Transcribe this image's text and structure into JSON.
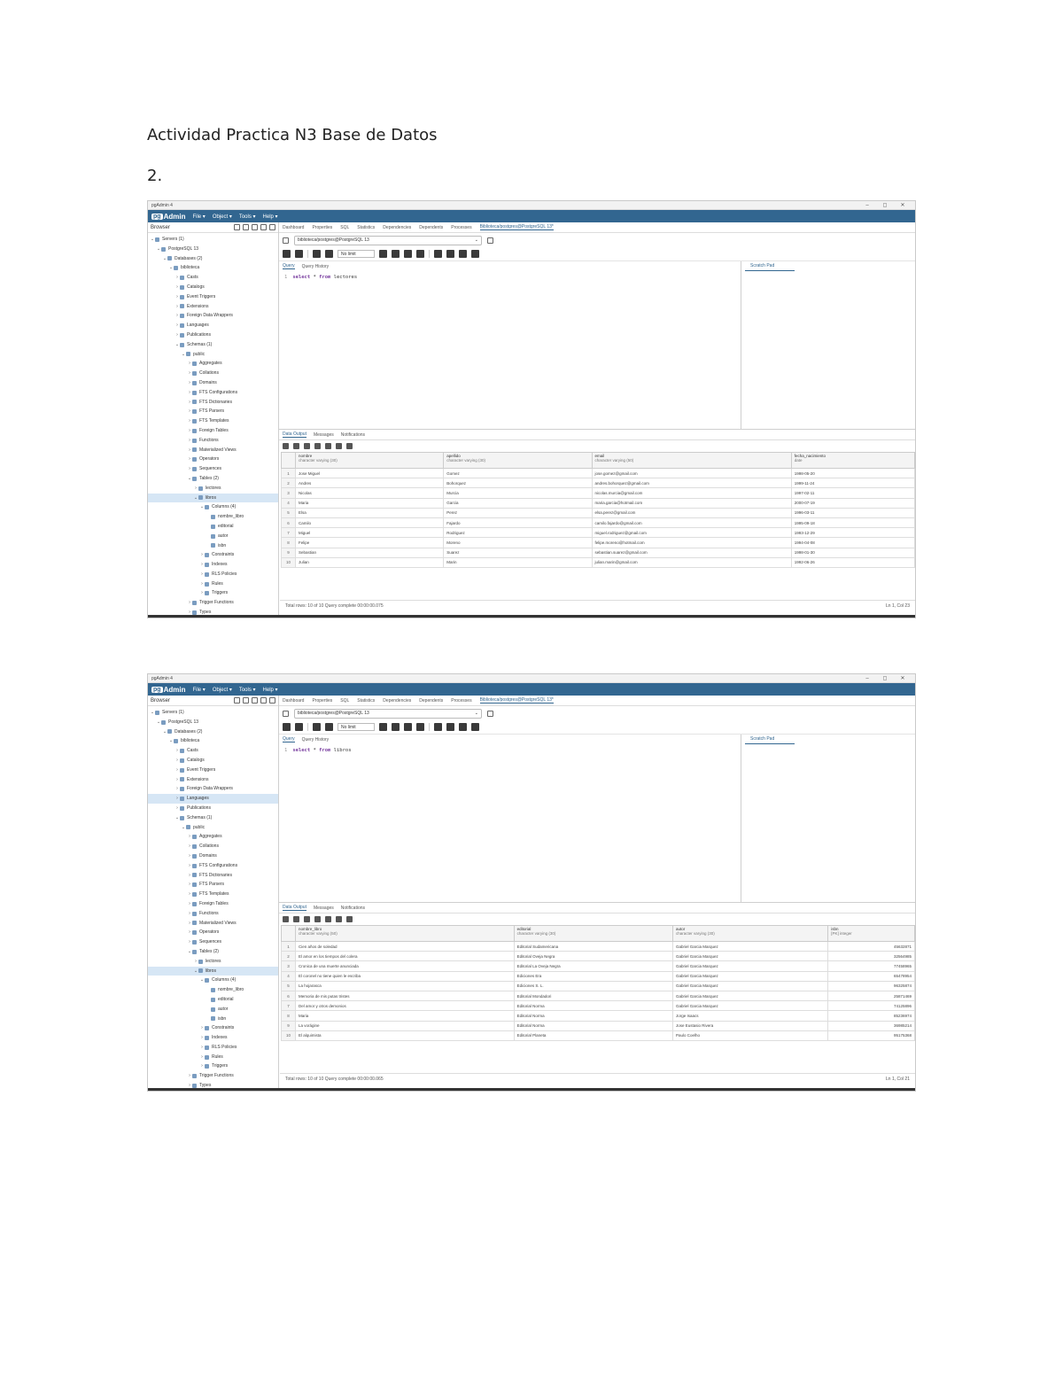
{
  "document": {
    "title": "Actividad Practica N3 Base de Datos",
    "section_number": "2."
  },
  "screenshots": [
    {
      "window_title": "pgAdmin 4",
      "logo_pg": "pg",
      "logo_admin": "Admin",
      "menu": [
        "File ▾",
        "Object ▾",
        "Tools ▾",
        "Help ▾"
      ],
      "browser_label": "Browser",
      "tabs": [
        "Dashboard",
        "Properties",
        "SQL",
        "Statistics",
        "Dependencies",
        "Dependents",
        "Processes",
        "Biblioteca/postgres@PostgreSQL 13*"
      ],
      "connection": "biblioteca/postgres@PostgreSQL 13",
      "no_limit": "No limit",
      "editor_tabs": [
        "Query",
        "Query History"
      ],
      "scratch_pad": "Scratch Pad",
      "code": {
        "line": "1",
        "keyword1": "select",
        "rest1": " * ",
        "keyword2": "from",
        "table": " lectores"
      },
      "output_tabs": [
        "Data Output",
        "Messages",
        "Notifications"
      ],
      "tree": [
        {
          "label": "Servers (1)",
          "indent": 0,
          "arrow": "⌄"
        },
        {
          "label": "PostgreSQL 13",
          "indent": 1,
          "arrow": "⌄"
        },
        {
          "label": "Databases (2)",
          "indent": 2,
          "arrow": "⌄"
        },
        {
          "label": "biblioteca",
          "indent": 3,
          "arrow": "⌄"
        },
        {
          "label": "Casts",
          "indent": 4,
          "arrow": "›"
        },
        {
          "label": "Catalogs",
          "indent": 4,
          "arrow": "›"
        },
        {
          "label": "Event Triggers",
          "indent": 4,
          "arrow": "›"
        },
        {
          "label": "Extensions",
          "indent": 4,
          "arrow": "›"
        },
        {
          "label": "Foreign Data Wrappers",
          "indent": 4,
          "arrow": "›"
        },
        {
          "label": "Languages",
          "indent": 4,
          "arrow": "›"
        },
        {
          "label": "Publications",
          "indent": 4,
          "arrow": "›"
        },
        {
          "label": "Schemas (1)",
          "indent": 4,
          "arrow": "⌄"
        },
        {
          "label": "public",
          "indent": 5,
          "arrow": "⌄"
        },
        {
          "label": "Aggregates",
          "indent": 6,
          "arrow": "›"
        },
        {
          "label": "Collations",
          "indent": 6,
          "arrow": "›"
        },
        {
          "label": "Domains",
          "indent": 6,
          "arrow": "›"
        },
        {
          "label": "FTS Configurations",
          "indent": 6,
          "arrow": "›"
        },
        {
          "label": "FTS Dictionaries",
          "indent": 6,
          "arrow": "›"
        },
        {
          "label": "FTS Parsers",
          "indent": 6,
          "arrow": "›"
        },
        {
          "label": "FTS Templates",
          "indent": 6,
          "arrow": "›"
        },
        {
          "label": "Foreign Tables",
          "indent": 6,
          "arrow": "›"
        },
        {
          "label": "Functions",
          "indent": 6,
          "arrow": "›"
        },
        {
          "label": "Materialized Views",
          "indent": 6,
          "arrow": "›"
        },
        {
          "label": "Operators",
          "indent": 6,
          "arrow": "›"
        },
        {
          "label": "Sequences",
          "indent": 6,
          "arrow": "›"
        },
        {
          "label": "Tables (2)",
          "indent": 6,
          "arrow": "⌄"
        },
        {
          "label": "lectores",
          "indent": 7,
          "arrow": "›"
        },
        {
          "label": "libros",
          "indent": 7,
          "arrow": "⌄",
          "selected": true
        },
        {
          "label": "Columns (4)",
          "indent": 8,
          "arrow": "⌄"
        },
        {
          "label": "nombre_libro",
          "indent": 9,
          "arrow": ""
        },
        {
          "label": "editorial",
          "indent": 9,
          "arrow": ""
        },
        {
          "label": "autor",
          "indent": 9,
          "arrow": ""
        },
        {
          "label": "isbn",
          "indent": 9,
          "arrow": ""
        },
        {
          "label": "Constraints",
          "indent": 8,
          "arrow": "›"
        },
        {
          "label": "Indexes",
          "indent": 8,
          "arrow": "›"
        },
        {
          "label": "RLS Policies",
          "indent": 8,
          "arrow": "›"
        },
        {
          "label": "Rules",
          "indent": 8,
          "arrow": "›"
        },
        {
          "label": "Triggers",
          "indent": 8,
          "arrow": "›"
        },
        {
          "label": "Trigger Functions",
          "indent": 6,
          "arrow": "›"
        },
        {
          "label": "Types",
          "indent": 6,
          "arrow": "›"
        }
      ],
      "grid": {
        "columns": [
          {
            "name": "nombre",
            "type": "character varying (30)"
          },
          {
            "name": "apellido",
            "type": "character varying (30)"
          },
          {
            "name": "email",
            "type": "character varying (50)"
          },
          {
            "name": "fecha_nacimiento",
            "type": "date"
          }
        ],
        "rows": [
          [
            "1",
            "Jose Miguel",
            "Gomez",
            "jose.gomez@gmail.com",
            "1998-05-20"
          ],
          [
            "2",
            "Andres",
            "Bohorquez",
            "andres.bohorquez@gmail.com",
            "1999-11-24"
          ],
          [
            "3",
            "Nicolas",
            "Murcia",
            "nicolas.murcia@gmail.com",
            "1997-02-11"
          ],
          [
            "4",
            "Maria",
            "Garcia",
            "maria.garcia@hotmail.com",
            "2000-07-19"
          ],
          [
            "5",
            "Elsa",
            "Perez",
            "elsa.perez@gmail.com",
            "1996-03-11"
          ],
          [
            "6",
            "Camilo",
            "Fajardo",
            "camilo.fajardo@gmail.com",
            "1995-09-18"
          ],
          [
            "7",
            "Miguel",
            "Rodriguez",
            "miguel.rodriguez@gmail.com",
            "1993-12-29"
          ],
          [
            "8",
            "Felipe",
            "Moreno",
            "felipe.moreno@hotmail.com",
            "1994-04-08"
          ],
          [
            "9",
            "Sebastian",
            "Suarez",
            "sebastian.suarez@gmail.com",
            "1998-01-30"
          ],
          [
            "10",
            "Julian",
            "Marin",
            "julian.marin@gmail.com",
            "1992-06-26"
          ]
        ]
      },
      "status_left": "Total rows: 10 of 10     Query complete 00:00:00.075",
      "status_right": "Ln 1, Col 23"
    },
    {
      "window_title": "pgAdmin 4",
      "logo_pg": "pg",
      "logo_admin": "Admin",
      "menu": [
        "File ▾",
        "Object ▾",
        "Tools ▾",
        "Help ▾"
      ],
      "browser_label": "Browser",
      "tabs": [
        "Dashboard",
        "Properties",
        "SQL",
        "Statistics",
        "Dependencies",
        "Dependents",
        "Processes",
        "Biblioteca/postgres@PostgreSQL 13*"
      ],
      "connection": "biblioteca/postgres@PostgreSQL 13",
      "no_limit": "No limit",
      "editor_tabs": [
        "Query",
        "Query History"
      ],
      "scratch_pad": "Scratch Pad",
      "code": {
        "line": "1",
        "keyword1": "select",
        "rest1": " * ",
        "keyword2": "from",
        "table": " libros"
      },
      "output_tabs": [
        "Data Output",
        "Messages",
        "Notifications"
      ],
      "tree": [
        {
          "label": "Servers (1)",
          "indent": 0,
          "arrow": "⌄"
        },
        {
          "label": "PostgreSQL 13",
          "indent": 1,
          "arrow": "⌄"
        },
        {
          "label": "Databases (2)",
          "indent": 2,
          "arrow": "⌄"
        },
        {
          "label": "biblioteca",
          "indent": 3,
          "arrow": "⌄"
        },
        {
          "label": "Casts",
          "indent": 4,
          "arrow": "›"
        },
        {
          "label": "Catalogs",
          "indent": 4,
          "arrow": "›"
        },
        {
          "label": "Event Triggers",
          "indent": 4,
          "arrow": "›"
        },
        {
          "label": "Extensions",
          "indent": 4,
          "arrow": "›"
        },
        {
          "label": "Foreign Data Wrappers",
          "indent": 4,
          "arrow": "›"
        },
        {
          "label": "Languages",
          "indent": 4,
          "arrow": "›",
          "selected": true
        },
        {
          "label": "Publications",
          "indent": 4,
          "arrow": "›"
        },
        {
          "label": "Schemas (1)",
          "indent": 4,
          "arrow": "⌄"
        },
        {
          "label": "public",
          "indent": 5,
          "arrow": "⌄"
        },
        {
          "label": "Aggregates",
          "indent": 6,
          "arrow": "›"
        },
        {
          "label": "Collations",
          "indent": 6,
          "arrow": "›"
        },
        {
          "label": "Domains",
          "indent": 6,
          "arrow": "›"
        },
        {
          "label": "FTS Configurations",
          "indent": 6,
          "arrow": "›"
        },
        {
          "label": "FTS Dictionaries",
          "indent": 6,
          "arrow": "›"
        },
        {
          "label": "FTS Parsers",
          "indent": 6,
          "arrow": "›"
        },
        {
          "label": "FTS Templates",
          "indent": 6,
          "arrow": "›"
        },
        {
          "label": "Foreign Tables",
          "indent": 6,
          "arrow": "›"
        },
        {
          "label": "Functions",
          "indent": 6,
          "arrow": "›"
        },
        {
          "label": "Materialized Views",
          "indent": 6,
          "arrow": "›"
        },
        {
          "label": "Operators",
          "indent": 6,
          "arrow": "›"
        },
        {
          "label": "Sequences",
          "indent": 6,
          "arrow": "›"
        },
        {
          "label": "Tables (2)",
          "indent": 6,
          "arrow": "⌄"
        },
        {
          "label": "lectores",
          "indent": 7,
          "arrow": "›"
        },
        {
          "label": "libros",
          "indent": 7,
          "arrow": "⌄",
          "selected": true
        },
        {
          "label": "Columns (4)",
          "indent": 8,
          "arrow": "⌄"
        },
        {
          "label": "nombre_libro",
          "indent": 9,
          "arrow": ""
        },
        {
          "label": "editorial",
          "indent": 9,
          "arrow": ""
        },
        {
          "label": "autor",
          "indent": 9,
          "arrow": ""
        },
        {
          "label": "isbn",
          "indent": 9,
          "arrow": ""
        },
        {
          "label": "Constraints",
          "indent": 8,
          "arrow": "›"
        },
        {
          "label": "Indexes",
          "indent": 8,
          "arrow": "›"
        },
        {
          "label": "RLS Policies",
          "indent": 8,
          "arrow": "›"
        },
        {
          "label": "Rules",
          "indent": 8,
          "arrow": "›"
        },
        {
          "label": "Triggers",
          "indent": 8,
          "arrow": "›"
        },
        {
          "label": "Trigger Functions",
          "indent": 6,
          "arrow": "›"
        },
        {
          "label": "Types",
          "indent": 6,
          "arrow": "›"
        }
      ],
      "grid": {
        "columns": [
          {
            "name": "nombre_libro",
            "type": "character varying (50)"
          },
          {
            "name": "editorial",
            "type": "character varying (30)"
          },
          {
            "name": "autor",
            "type": "character varying (30)"
          },
          {
            "name": "isbn",
            "type": "[PK] integer"
          }
        ],
        "rows": [
          [
            "1",
            "Cien años de soledad",
            "Editorial Sudamericana",
            "Gabriel Garcia Marquez",
            "45632871"
          ],
          [
            "2",
            "El amor en los tiempos del colera",
            "Editorial Oveja Negra",
            "Gabriel Garcia Marquez",
            "32564985"
          ],
          [
            "3",
            "Cronica de una muerte anunciada",
            "Editorial La Oveja Negra",
            "Gabriel Garcia Marquez",
            "77458965"
          ],
          [
            "4",
            "El coronel no tiene quien le escriba",
            "Ediciones Era",
            "Gabriel Garcia Marquez",
            "65478954"
          ],
          [
            "5",
            "La hojarasca",
            "Ediciones S. L.",
            "Gabriel Garcia Marquez",
            "96325874"
          ],
          [
            "6",
            "Memoria de mis putas tristes",
            "Editorial Mondadori",
            "Gabriel Garcia Marquez",
            "25871469"
          ],
          [
            "7",
            "Del amor y otros demonios",
            "Editorial Norma",
            "Gabriel Garcia Marquez",
            "74125896"
          ],
          [
            "8",
            "Maria",
            "Editorial Norma",
            "Jorge Isaacs",
            "85236974"
          ],
          [
            "9",
            "La vorágine",
            "Editorial Norma",
            "Jose Eustasio Rivera",
            "36985214"
          ],
          [
            "10",
            "El alquimista",
            "Editorial Planeta",
            "Paulo Coelho",
            "95175368"
          ]
        ]
      },
      "status_left": "Total rows: 10 of 10     Query complete 00:00:00.065",
      "status_right": "Ln 1, Col 21"
    }
  ]
}
